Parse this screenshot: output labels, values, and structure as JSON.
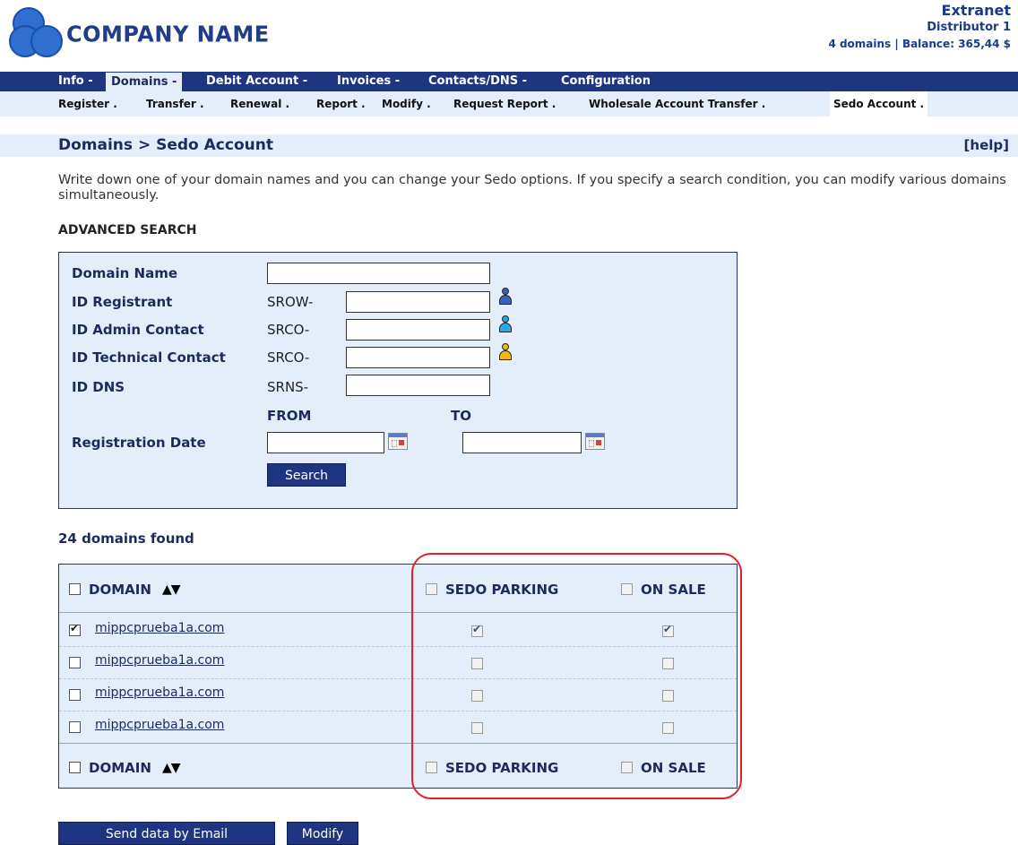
{
  "header": {
    "company_name": "COMPANY NAME",
    "extranet": "Extranet",
    "distributor": "Distributor 1",
    "summary": "4 domains | Balance: 365,44 $"
  },
  "main_nav": {
    "info": "Info -",
    "domains": "Domains -",
    "debit_account": "Debit Account -",
    "invoices": "Invoices -",
    "contacts_dns": "Contacts/DNS -",
    "configuration": "Configuration"
  },
  "sub_nav": {
    "register": "Register .",
    "transfer": "Transfer .",
    "renewal": "Renewal .",
    "report": "Report .",
    "modify": "Modify .",
    "request_report": "Request Report .",
    "wholesale": "Wholesale Account Transfer .",
    "sedo_account": "Sedo Account ."
  },
  "page": {
    "breadcrumb": "Domains > Sedo Account",
    "help": "[help]",
    "description": "Write down one of your domain names and you can change your Sedo options. If you specify a search condition, you can modify various domains simultaneously.",
    "advanced_search": "ADVANCED SEARCH"
  },
  "search": {
    "domain_name_label": "Domain Name",
    "registrant_label": "ID Registrant",
    "registrant_prefix": "SROW-",
    "admin_label": "ID Admin Contact",
    "admin_prefix": "SRCO-",
    "tech_label": "ID Technical Contact",
    "tech_prefix": "SRCO-",
    "dns_label": "ID DNS",
    "dns_prefix": "SRNS-",
    "from_label": "FROM",
    "to_label": "TO",
    "reg_date_label": "Registration Date",
    "search_button": "Search",
    "icons": {
      "registrant": "person-blue-icon",
      "admin": "person-cyan-icon",
      "tech": "person-yellow-icon",
      "calendar": "calendar-icon"
    },
    "icon_colors": {
      "registrant": "#3a63b8",
      "admin": "#29a7e6",
      "tech": "#f2b90f"
    }
  },
  "results": {
    "count_text": "24 domains found",
    "col_domain": "DOMAIN",
    "col_sedo_parking": "SEDO PARKING",
    "col_on_sale": "ON SALE",
    "sort_arrows": "▲▼",
    "rows": [
      {
        "domain": "mippcprueba1a.com",
        "selected": true,
        "sedo_parking": true,
        "on_sale": true
      },
      {
        "domain": "mippcprueba1a.com",
        "selected": false,
        "sedo_parking": false,
        "on_sale": false
      },
      {
        "domain": "mippcprueba1a.com",
        "selected": false,
        "sedo_parking": false,
        "on_sale": false
      },
      {
        "domain": "mippcprueba1a.com",
        "selected": false,
        "sedo_parking": false,
        "on_sale": false
      }
    ]
  },
  "actions": {
    "send_email": "Send data by Email",
    "modify": "Modify"
  },
  "colors": {
    "nav_bg": "#1e3582",
    "light_bg": "#e3eefa",
    "highlight": "#e3202a"
  }
}
